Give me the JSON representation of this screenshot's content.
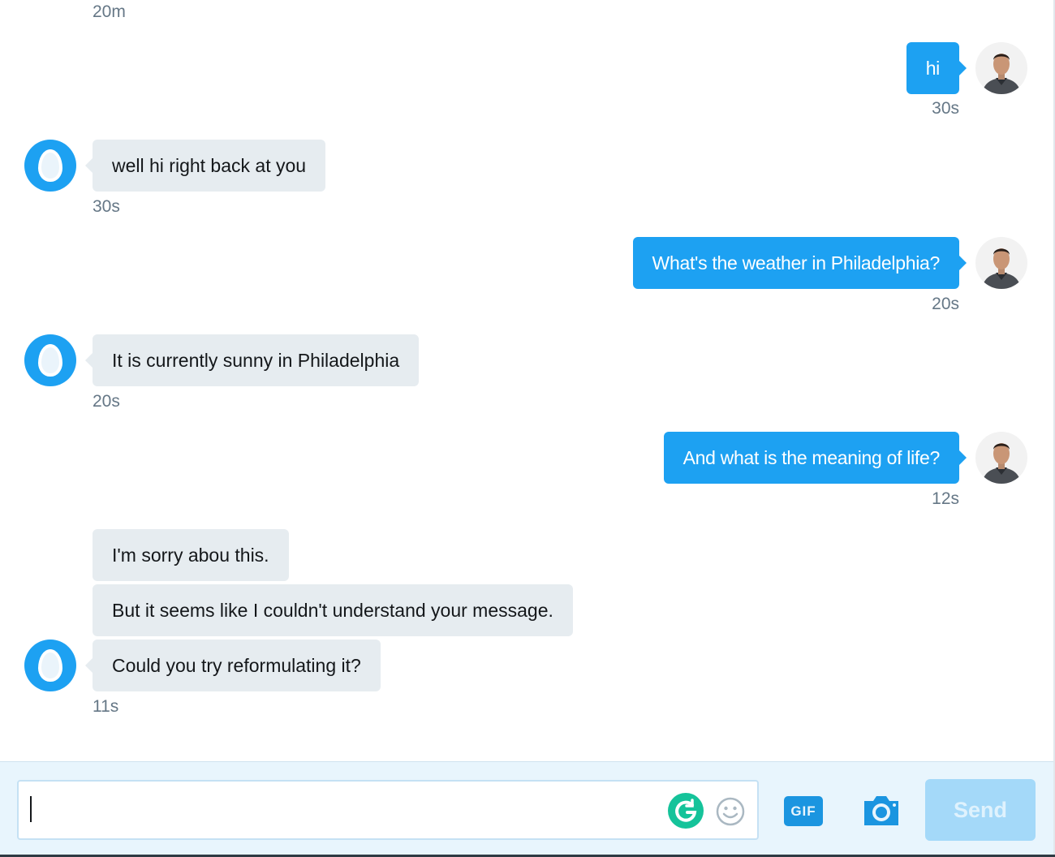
{
  "conversation": {
    "top_timestamp": "20m",
    "messages": [
      {
        "sender": "user",
        "text": "hi",
        "time": "30s"
      },
      {
        "sender": "bot",
        "text": "well hi right back at you",
        "time": "30s"
      },
      {
        "sender": "user",
        "text": "What's the weather in Philadelphia?",
        "time": "20s"
      },
      {
        "sender": "bot",
        "text": "It is currently sunny in Philadelphia",
        "time": "20s"
      },
      {
        "sender": "user",
        "text": "And what is the meaning of life?",
        "time": "12s"
      },
      {
        "sender": "bot",
        "text": "I'm sorry abou this.",
        "time": ""
      },
      {
        "sender": "bot",
        "text": "But it seems like I couldn't understand your message.",
        "time": ""
      },
      {
        "sender": "bot",
        "text": "Could you try reformulating it?",
        "time": "11s"
      }
    ]
  },
  "composer": {
    "value": "",
    "gif_label": "GIF",
    "send_label": "Send"
  },
  "colors": {
    "accent": "#1da1f2",
    "incoming_bubble": "#e6ecf0",
    "timestamp": "#657786",
    "send_disabled": "#a4d9f9",
    "grammarly": "#15c39a"
  },
  "icons": {
    "bot_avatar": "egg-avatar-icon",
    "user_avatar": "user-photo-avatar",
    "grammarly": "grammarly-icon",
    "emoji": "emoji-smiley-icon",
    "gif": "gif-icon",
    "camera": "camera-icon"
  }
}
